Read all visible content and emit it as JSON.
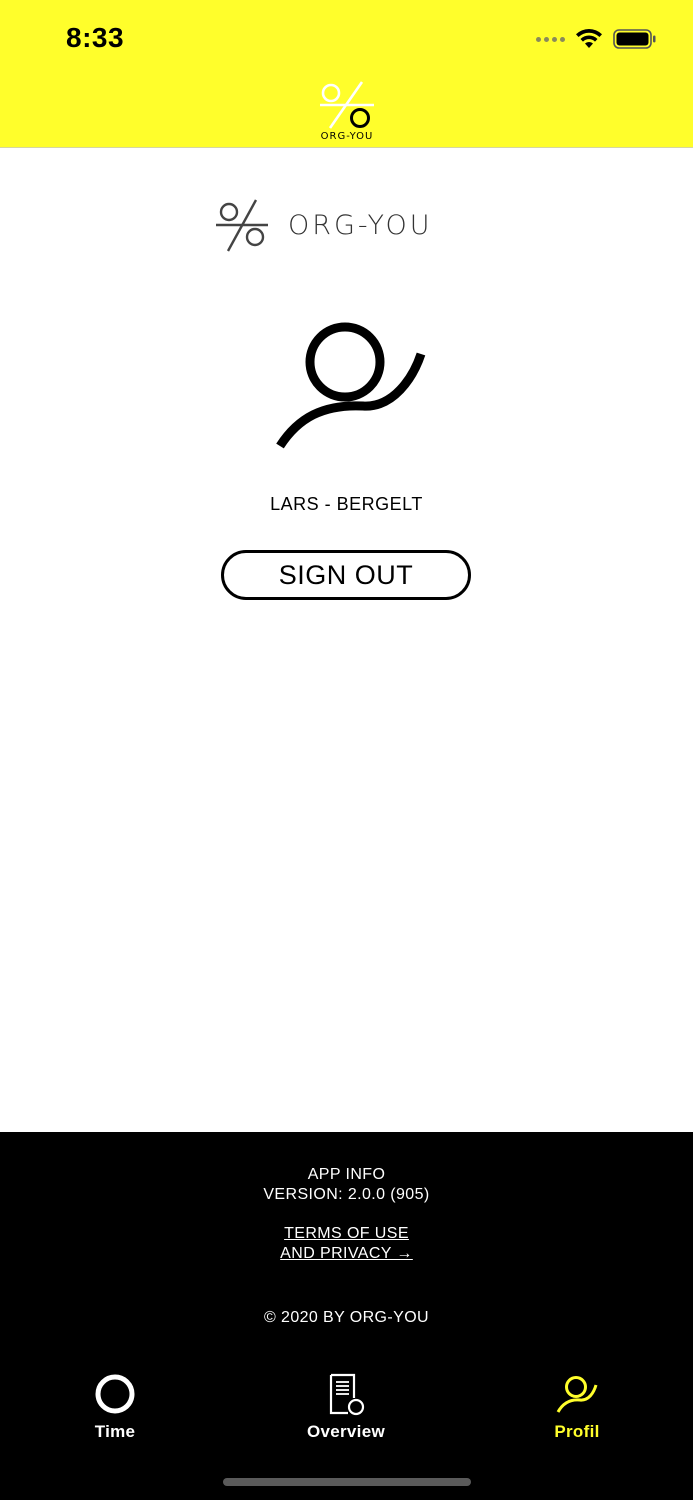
{
  "status_bar": {
    "time": "8:33"
  },
  "header": {
    "logo_text": "ORG-YOU"
  },
  "main": {
    "brand_name": "ORG-YOU",
    "user_name": "LARS - BERGELT",
    "sign_out_label": "SIGN OUT"
  },
  "footer": {
    "app_info_title": "APP INFO",
    "version": "VERSION: 2.0.0 (905)",
    "terms_line1": "TERMS OF USE",
    "terms_line2": "AND PRIVACY →",
    "copyright": "© 2020 BY ORG-YOU"
  },
  "tabs": [
    {
      "label": "Time",
      "icon": "circle-icon",
      "active": false
    },
    {
      "label": "Overview",
      "icon": "document-icon",
      "active": false
    },
    {
      "label": "Profil",
      "icon": "profile-icon",
      "active": true
    }
  ],
  "colors": {
    "accent": "#FFFE2B",
    "footer_bg": "#000000"
  }
}
